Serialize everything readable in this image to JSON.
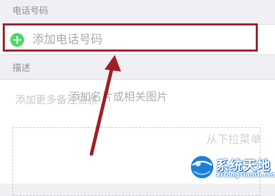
{
  "phone_section": {
    "header": "电话号码",
    "add_phone_label": "添加电话号码"
  },
  "description_section": {
    "header": "描述",
    "note_placeholder": "添加更多备注信息",
    "upload_hint": "从下拉菜单",
    "attach_label": "添加名片或相关图片"
  },
  "watermark": {
    "title": "系统天地",
    "subtitle": "XiTongTianDi.net"
  },
  "colors": {
    "highlight": "#a01e26",
    "add_icon": "#4cd964",
    "background": "#efeff4"
  }
}
